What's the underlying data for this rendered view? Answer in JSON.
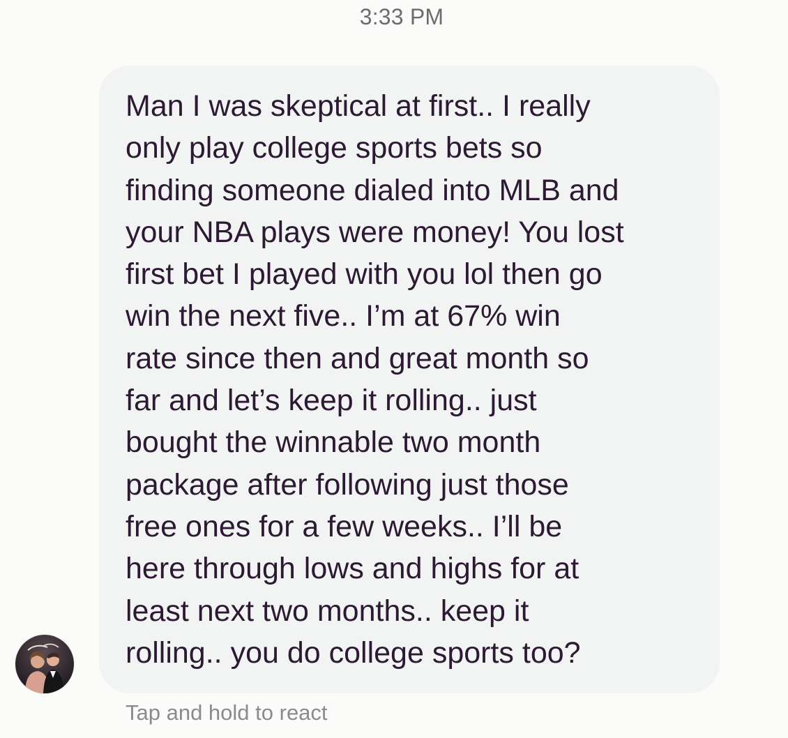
{
  "header": {
    "timestamp": "3:33 PM"
  },
  "conversation": {
    "message": {
      "text": "Man I was skeptical at first.. I really\nonly play college sports bets so\nfinding someone dialed into MLB and\nyour NBA plays were money! You lost\nfirst bet I played with you lol then go\nwin the next five.. I’m at 67% win\nrate since then and great month so\nfar and let’s keep it rolling.. just\nbought the winnable two month\npackage after following just those\nfree ones for a few weeks.. I’ll be\nhere through lows and highs for at\nleast next two months.. keep it\nrolling.. you do college sports too?",
      "sender_avatar": "profile-photo"
    },
    "hint": "Tap and hold to react"
  },
  "colors": {
    "background": "#fbfbfa",
    "bubble": "#f2f3f3",
    "message_text": "#2c1932",
    "timestamp": "#6d6b6f",
    "hint": "#8d8a8f"
  }
}
